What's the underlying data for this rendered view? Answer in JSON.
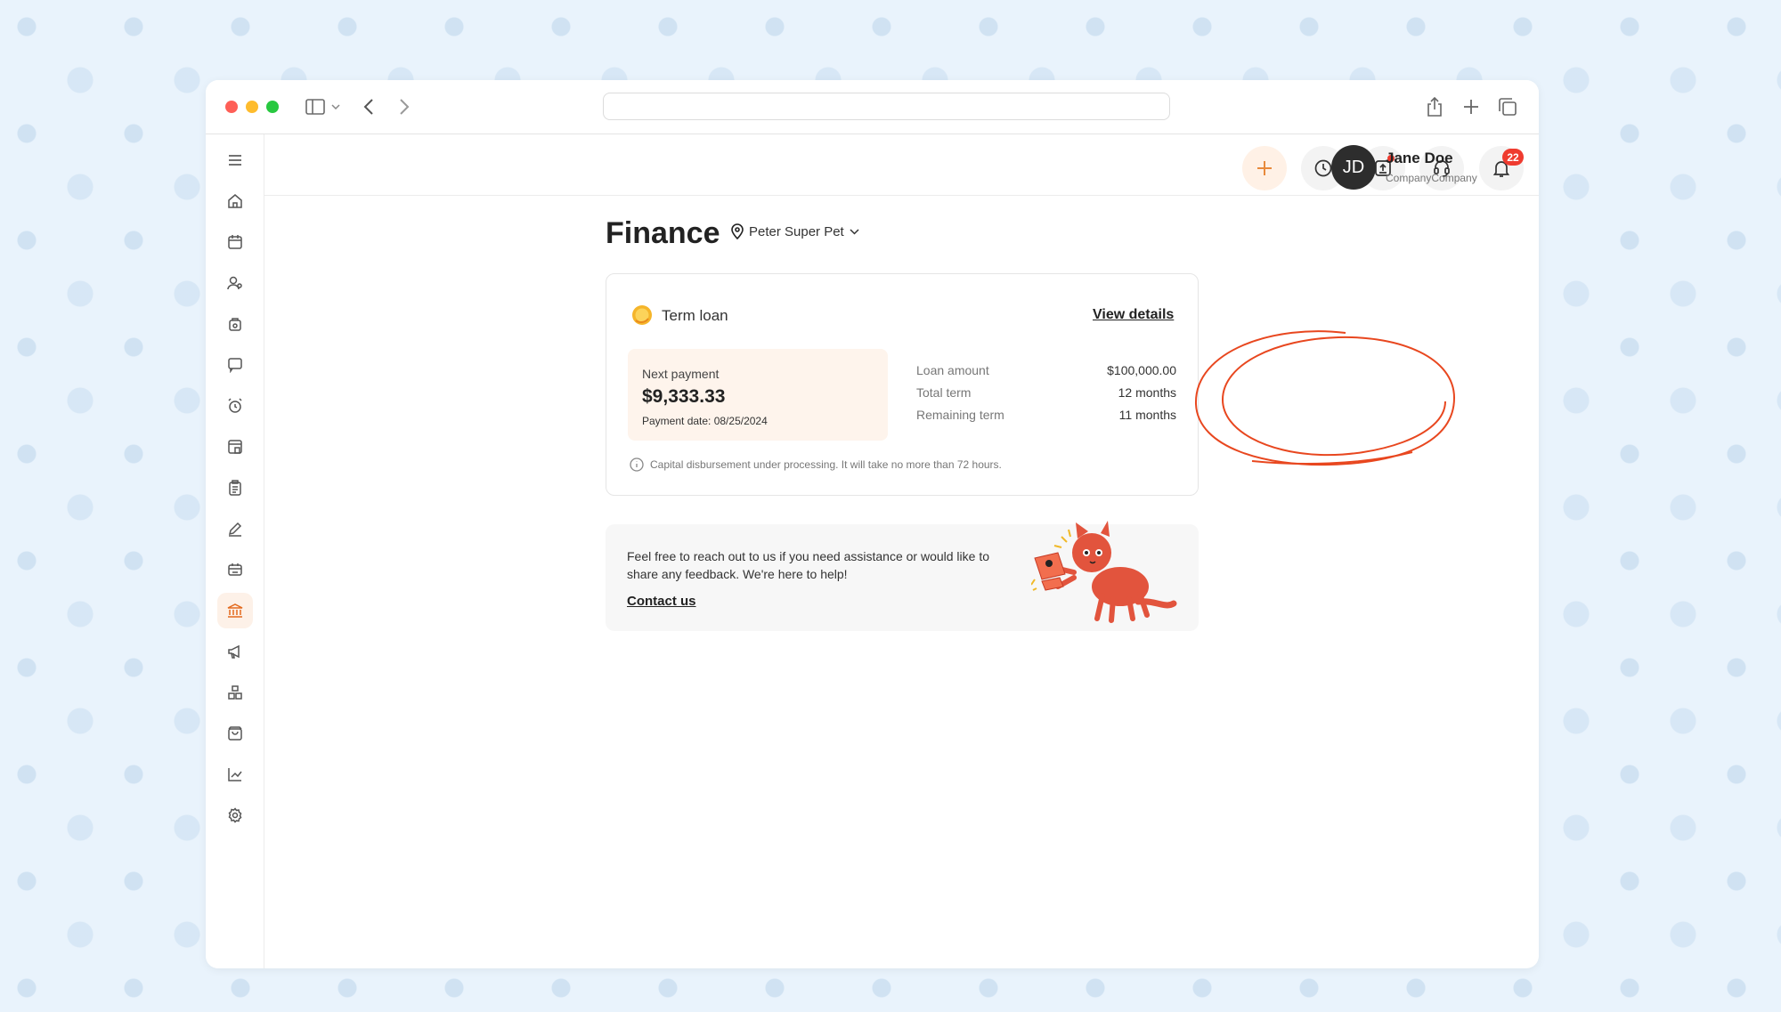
{
  "browser": {
    "address_value": "",
    "colors": {
      "close": "#fe5f57",
      "minimize": "#febc2e",
      "zoom": "#28c840"
    }
  },
  "sidebar": {
    "items": [
      {
        "name": "menu-icon"
      },
      {
        "name": "home-icon"
      },
      {
        "name": "calendar-icon"
      },
      {
        "name": "clients-icon"
      },
      {
        "name": "pet-bag-icon"
      },
      {
        "name": "message-icon"
      },
      {
        "name": "alarm-icon"
      },
      {
        "name": "store-icon"
      },
      {
        "name": "clipboard-icon"
      },
      {
        "name": "edit-icon"
      },
      {
        "name": "booking-icon"
      },
      {
        "name": "bank-icon",
        "active": true
      },
      {
        "name": "megaphone-icon"
      },
      {
        "name": "boxes-icon"
      },
      {
        "name": "shopping-bag-icon"
      },
      {
        "name": "chart-icon"
      },
      {
        "name": "settings-icon"
      }
    ]
  },
  "topbar": {
    "notification_count": "22",
    "user": {
      "initials": "JD",
      "name": "Jane Doe",
      "company": "CompanyCompany"
    }
  },
  "page": {
    "title": "Finance",
    "location": "Peter Super Pet"
  },
  "loan": {
    "title": "Term loan",
    "view_details": "View details",
    "next_payment_label": "Next payment",
    "next_payment_amount": "$9,333.33",
    "payment_date": "Payment date: 08/25/2024",
    "details": [
      {
        "label": "Loan amount",
        "value": "$100,000.00"
      },
      {
        "label": "Total term",
        "value": "12 months"
      },
      {
        "label": "Remaining term",
        "value": "11 months"
      }
    ],
    "info": "Capital disbursement under processing. It will take no more than 72 hours."
  },
  "help": {
    "text": "Feel free to reach out to us if you need assistance or would like to share any feedback. We're here to help!",
    "contact": "Contact us"
  },
  "colors": {
    "accent": "#e36b1f",
    "annotation": "#e8471f",
    "badge": "#ef3b2f"
  }
}
